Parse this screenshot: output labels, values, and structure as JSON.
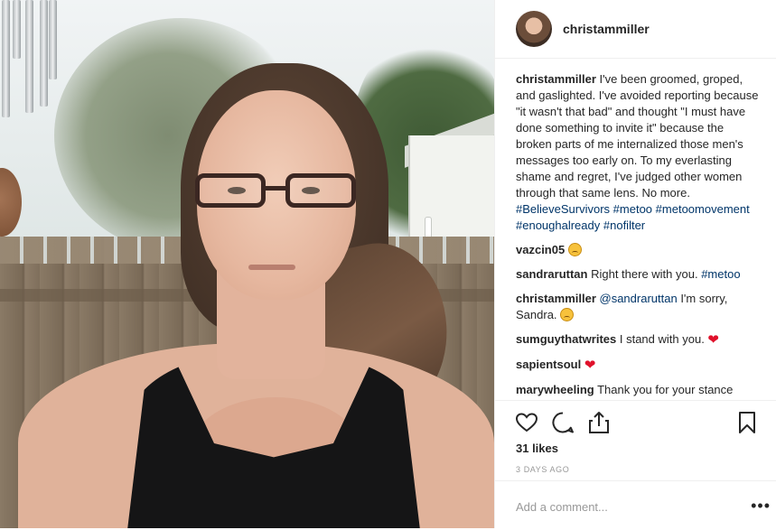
{
  "post": {
    "username": "christammiller",
    "likes": "31 likes",
    "time": "3 DAYS AGO",
    "add_comment_placeholder": "Add a comment...",
    "more_label": "•••"
  },
  "comments": [
    {
      "user": "christammiller",
      "text": " I've been groomed, groped, and gaslighted. I've avoided reporting because \"it wasn't that bad\" and thought \"I must have done something to invite it\" because the broken parts of me internalized those men's messages too early on. To my everlasting shame and regret, I've judged other women through that same lens. No more. ",
      "tags": [
        "#BelieveSurvivors",
        "#metoo",
        "#metoomovement",
        "#enoughalready",
        "#nofilter"
      ]
    },
    {
      "user": "vazcin05",
      "text": " ",
      "emoji": "sad-face"
    },
    {
      "user": "sandraruttan",
      "text": " Right there with you. ",
      "tag": "#metoo"
    },
    {
      "user": "christammiller",
      "mention": "@sandraruttan",
      "text": " I'm sorry, Sandra. ",
      "emoji": "sad-face"
    },
    {
      "user": "sumguythatwrites",
      "text": " I stand with you. ",
      "emoji": "red-heart"
    },
    {
      "user": "sapientsoul",
      "text": " ",
      "emoji": "red-heart"
    },
    {
      "user": "marywheeling",
      "text": " Thank you for your stance"
    }
  ],
  "icons": [
    "heart-outline-icon",
    "comment-icon",
    "share-icon",
    "bookmark-icon"
  ]
}
